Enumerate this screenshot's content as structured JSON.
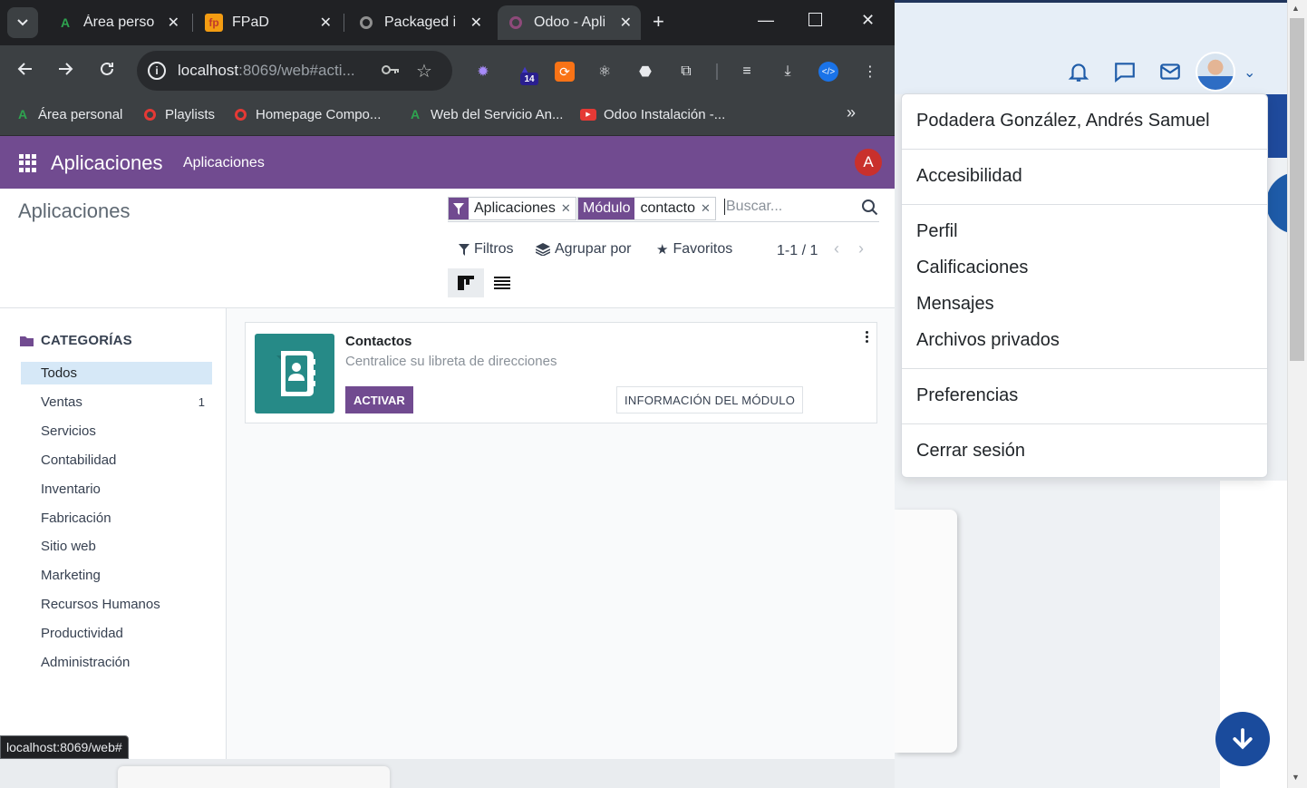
{
  "browser": {
    "tabs": [
      {
        "label": "Área personal",
        "favicon": "A",
        "active": false
      },
      {
        "label": "FPaD",
        "favicon": "fp",
        "active": false
      },
      {
        "label": "Packaged install",
        "favicon": "odoo-ring",
        "active": false
      },
      {
        "label": "Odoo - Aplicaciones",
        "favicon": "odoo-ring",
        "active": true
      }
    ],
    "address": {
      "host": "localhost",
      "rest": ":8069/web#acti..."
    },
    "extension_badge": "14",
    "bookmarks": [
      {
        "label": "Área personal",
        "icon": "A"
      },
      {
        "label": "Playlists",
        "icon": "ring"
      },
      {
        "label": "Homepage Compo...",
        "icon": "ring"
      },
      {
        "label": "Web del Servicio An...",
        "icon": "A"
      },
      {
        "label": "Odoo Instalación -...",
        "icon": "youtube"
      }
    ],
    "status_url": "localhost:8069/web#",
    "colors": {
      "tabstrip": "#202124",
      "toolbar": "#3c4043"
    }
  },
  "odoo": {
    "brand": "Aplicaciones",
    "menu": [
      "Aplicaciones"
    ],
    "avatar_letter": "A",
    "breadcrumb": "Aplicaciones",
    "search": {
      "facets": [
        {
          "tag": "",
          "value": "Aplicaciones",
          "icon": "filter-icon"
        },
        {
          "tag": "Módulo",
          "value": "contacto"
        }
      ],
      "placeholder": "Buscar..."
    },
    "buttons": {
      "filters": "Filtros",
      "group_by": "Agrupar por",
      "favorites": "Favoritos"
    },
    "pager": "1-1 / 1",
    "sidebar": {
      "header": "CATEGORÍAS",
      "items": [
        {
          "label": "Todos",
          "count": "",
          "active": true
        },
        {
          "label": "Ventas",
          "count": "1",
          "active": false
        },
        {
          "label": "Servicios",
          "count": "",
          "active": false
        },
        {
          "label": "Contabilidad",
          "count": "",
          "active": false
        },
        {
          "label": "Inventario",
          "count": "",
          "active": false
        },
        {
          "label": "Fabricación",
          "count": "",
          "active": false
        },
        {
          "label": "Sitio web",
          "count": "",
          "active": false
        },
        {
          "label": "Marketing",
          "count": "",
          "active": false
        },
        {
          "label": "Recursos Humanos",
          "count": "",
          "active": false
        },
        {
          "label": "Productividad",
          "count": "",
          "active": false
        },
        {
          "label": "Administración",
          "count": "",
          "active": false
        }
      ]
    },
    "card": {
      "name": "Contactos",
      "description": "Centralice su libreta de direcciones",
      "activate": "ACTIVAR",
      "info": "INFORMACIÓN DEL MÓDULO"
    },
    "colors": {
      "primary": "#714b90",
      "icon_bg": "#268a87",
      "active_category": "#d6e8f7"
    }
  },
  "user_menu": {
    "name": "Podadera González, Andrés Samuel",
    "items": [
      "Accesibilidad",
      "Perfil",
      "Calificaciones",
      "Mensajes",
      "Archivos privados",
      "Preferencias",
      "Cerrar sesión"
    ]
  }
}
